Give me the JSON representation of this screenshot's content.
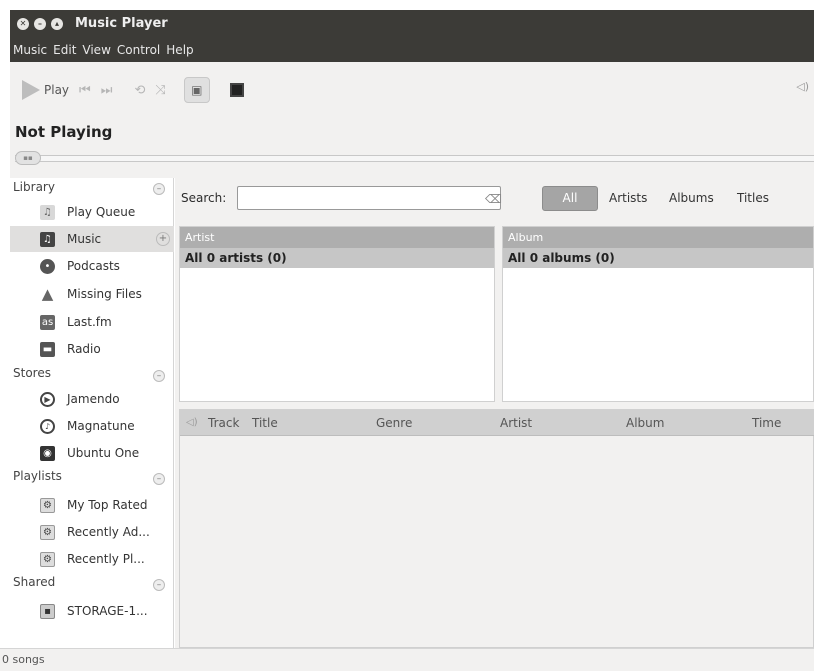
{
  "window": {
    "title": "Music Player"
  },
  "menu": [
    "Music",
    "Edit",
    "View",
    "Control",
    "Help"
  ],
  "toolbar": {
    "play_label": "Play"
  },
  "now_playing": "Not Playing",
  "sidebar": {
    "library_title": "Library",
    "library_items": [
      "Play Queue",
      "Music",
      "Podcasts",
      "Missing Files",
      "Last.fm",
      "Radio"
    ],
    "stores_title": "Stores",
    "stores_items": [
      "Jamendo",
      "Magnatune",
      "Ubuntu One"
    ],
    "playlists_title": "Playlists",
    "playlists_items": [
      "My Top Rated",
      "Recently Ad...",
      "Recently Pl..."
    ],
    "shared_title": "Shared",
    "shared_items": [
      "STORAGE-1..."
    ]
  },
  "search": {
    "label": "Search:",
    "value": ""
  },
  "filters": [
    "All",
    "Artists",
    "Albums",
    "Titles"
  ],
  "browser": {
    "artist_header": "Artist",
    "artist_row": "All 0 artists (0)",
    "album_header": "Album",
    "album_row": "All 0 albums (0)"
  },
  "tracks": {
    "columns": [
      "Track",
      "Title",
      "Genre",
      "Artist",
      "Album",
      "Time"
    ]
  },
  "status": "0 songs"
}
